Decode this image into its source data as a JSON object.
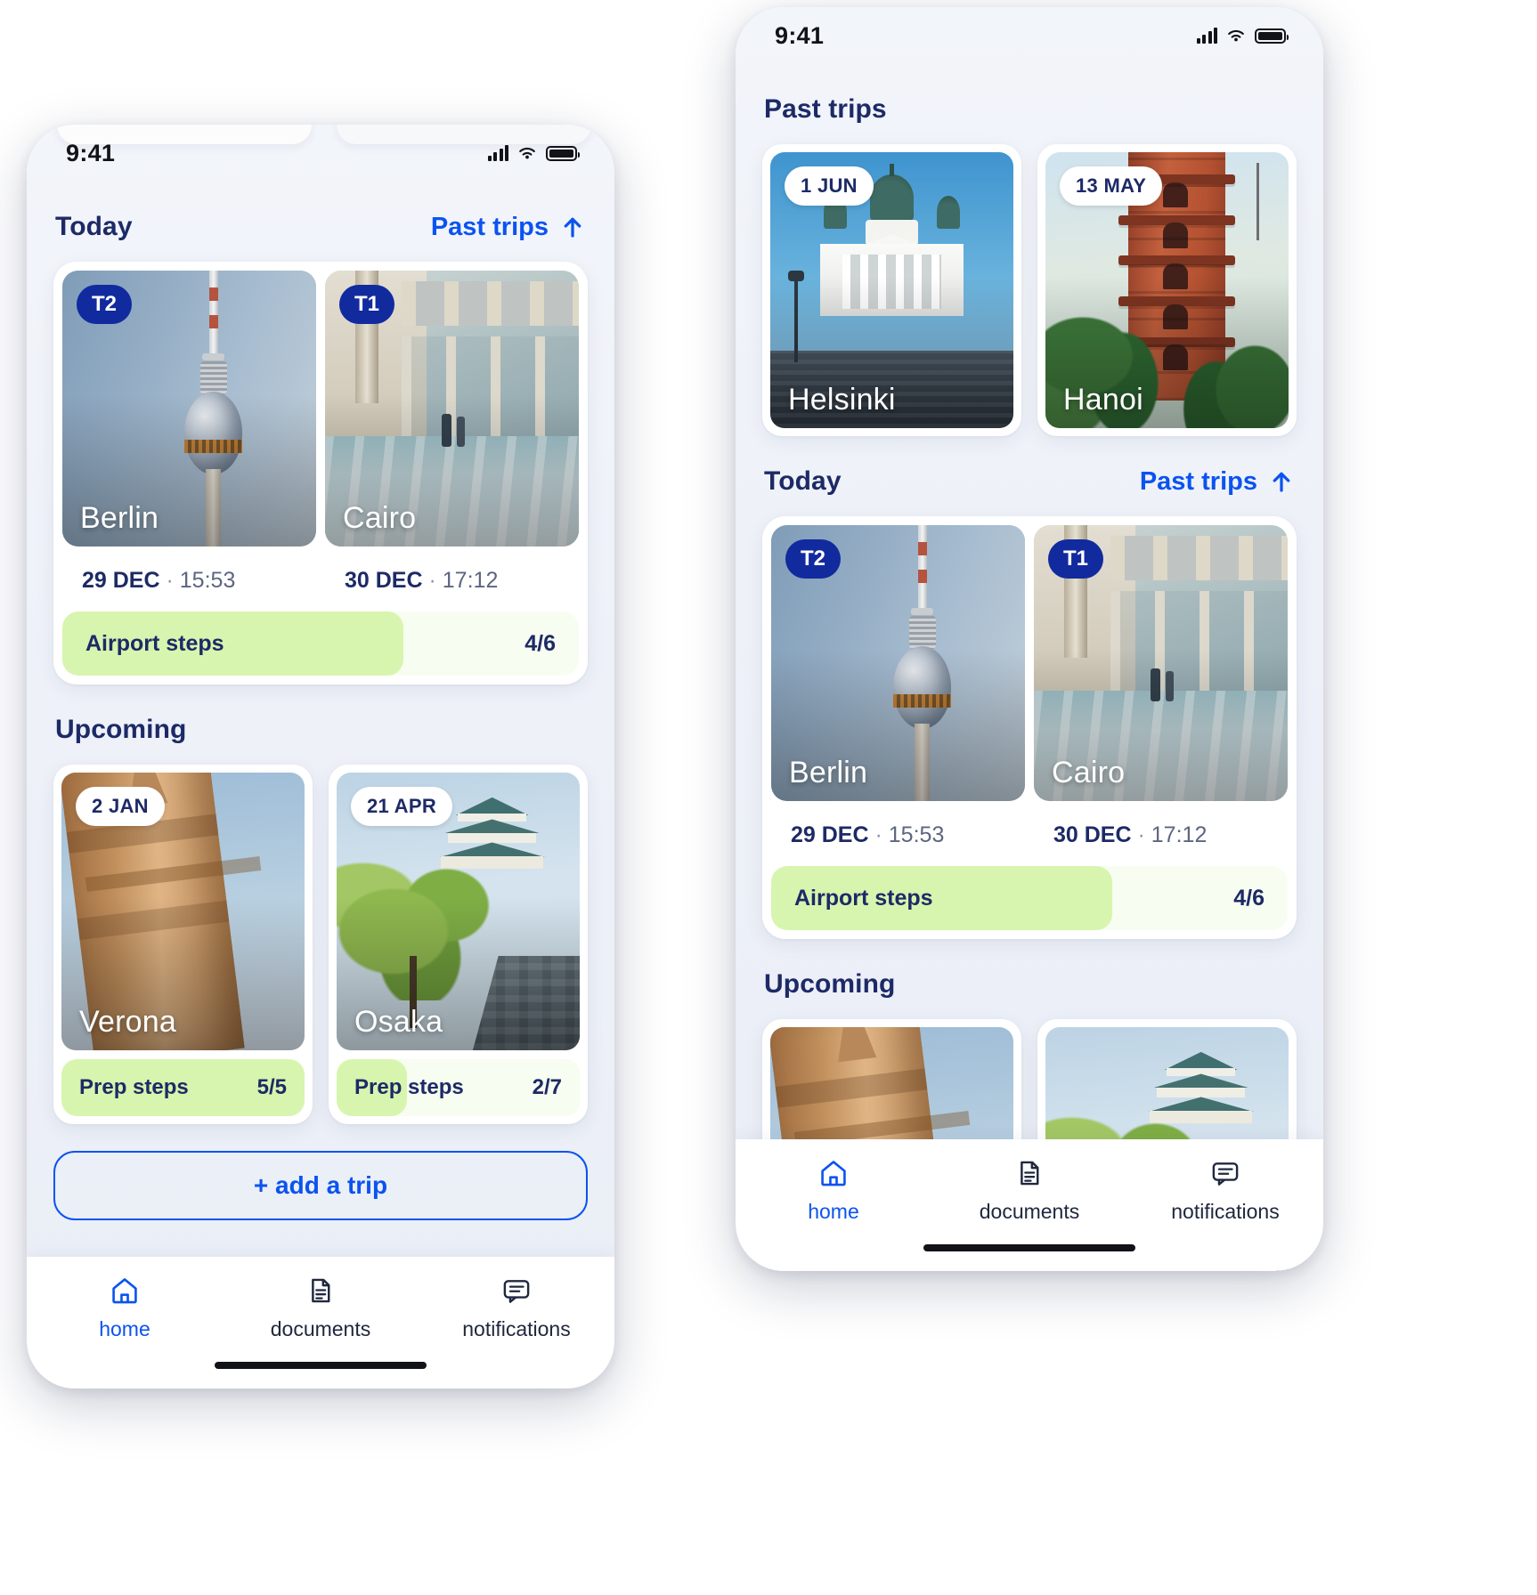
{
  "status_bar": {
    "time": "9:41",
    "icons": [
      "cellular-signal-icon",
      "wifi-icon",
      "battery-icon"
    ]
  },
  "colors": {
    "accent_blue": "#0b53f0",
    "navy": "#1d2a66",
    "badge_navy": "#112a9e",
    "progress_fill": "#d7f5ae",
    "progress_track": "#f7fdf0",
    "screen_bg": "#eef1f8"
  },
  "left_phone": {
    "sections": {
      "today": {
        "title": "Today",
        "past_trips_link": "Past trips",
        "group_card": {
          "tiles": [
            {
              "terminal": "T2",
              "city": "Berlin",
              "date": "29 DEC",
              "separator": "·",
              "time": "15:53"
            },
            {
              "terminal": "T1",
              "city": "Cairo",
              "date": "30 DEC",
              "separator": "·",
              "time": "17:12"
            }
          ],
          "steps": {
            "label": "Airport steps",
            "count": "4/6",
            "percent": 66
          }
        }
      },
      "upcoming": {
        "title": "Upcoming",
        "cards": [
          {
            "date_badge": "2 JAN",
            "city": "Verona",
            "steps_label": "Prep steps",
            "steps_count": "5/5",
            "percent": 100
          },
          {
            "date_badge": "21 APR",
            "city": "Osaka",
            "steps_label": "Prep steps",
            "steps_count": "2/7",
            "percent": 29
          }
        ]
      },
      "cta": {
        "label": "+ add a trip"
      }
    },
    "tabbar": {
      "tabs": [
        {
          "icon": "home-icon",
          "label": "home",
          "active": true
        },
        {
          "icon": "documents-icon",
          "label": "documents",
          "active": false
        },
        {
          "icon": "notifications-icon",
          "label": "notifications",
          "active": false
        }
      ]
    }
  },
  "right_phone": {
    "sections": {
      "past_trips": {
        "title": "Past trips",
        "cards": [
          {
            "date_badge": "1 JUN",
            "city": "Helsinki"
          },
          {
            "date_badge": "13 MAY",
            "city": "Hanoi"
          }
        ]
      },
      "today": {
        "title": "Today",
        "past_trips_link": "Past trips",
        "group_card": {
          "tiles": [
            {
              "terminal": "T2",
              "city": "Berlin",
              "date": "29 DEC",
              "separator": "·",
              "time": "15:53"
            },
            {
              "terminal": "T1",
              "city": "Cairo",
              "date": "30 DEC",
              "separator": "·",
              "time": "17:12"
            }
          ],
          "steps": {
            "label": "Airport steps",
            "count": "4/6",
            "percent": 66
          }
        }
      },
      "upcoming": {
        "title": "Upcoming"
      }
    },
    "tabbar": {
      "tabs": [
        {
          "icon": "home-icon",
          "label": "home",
          "active": true
        },
        {
          "icon": "documents-icon",
          "label": "documents",
          "active": false
        },
        {
          "icon": "notifications-icon",
          "label": "notifications",
          "active": false
        }
      ]
    }
  }
}
